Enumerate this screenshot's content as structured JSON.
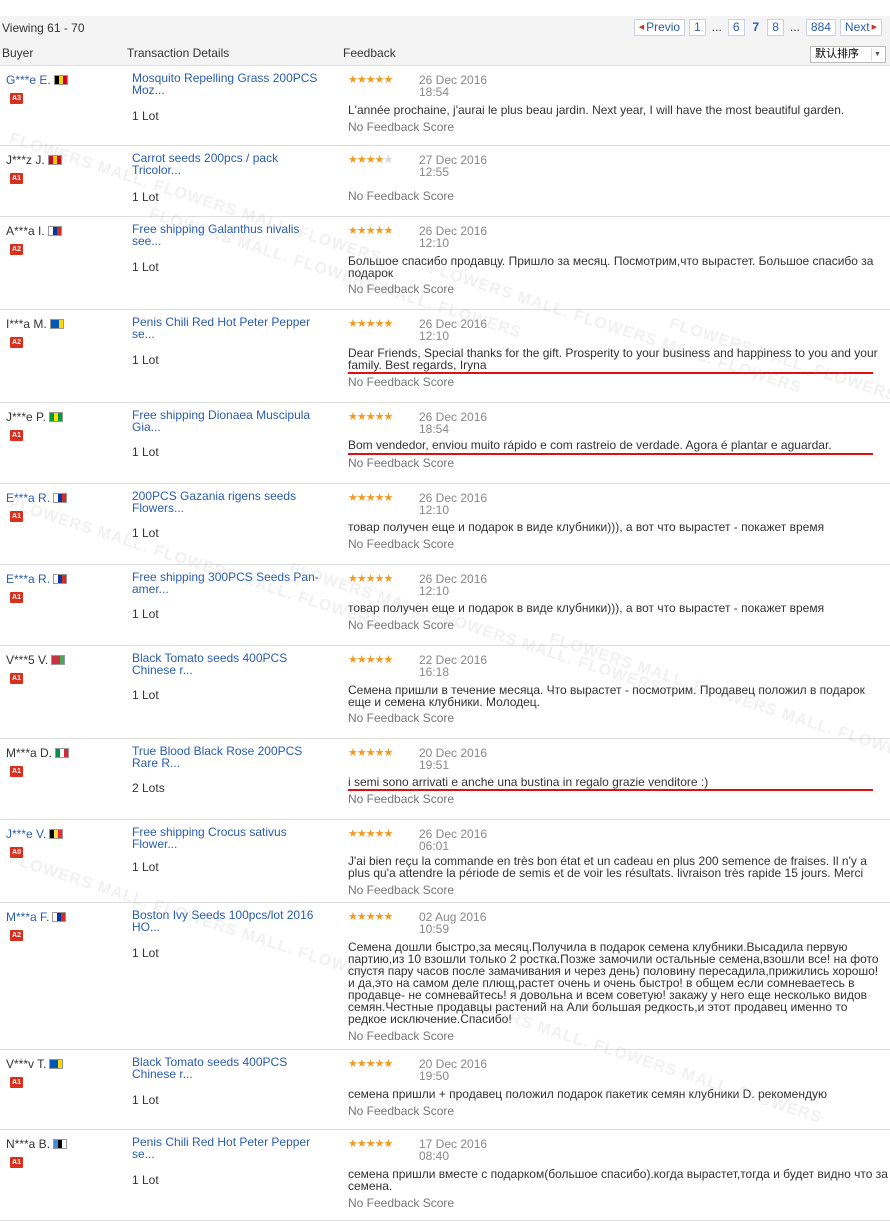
{
  "pagination": {
    "viewing": "Viewing 61 - 70",
    "prev_label": "Previo",
    "pages": [
      "1",
      "...",
      "6",
      "7",
      "8",
      "...",
      "884"
    ],
    "current_page": "7",
    "next_label": "Next"
  },
  "columns": {
    "buyer": "Buyer",
    "transaction": "Transaction Details",
    "feedback": "Feedback"
  },
  "sort": {
    "selected": "默认排序"
  },
  "watermark": "FLOWERS MALL. FLOWERS MALL. FLOWERS",
  "colors": {
    "link": "#2a5db0",
    "star": "#f39a1e",
    "badge": "#d9301e",
    "underline": "#e01010"
  },
  "rows": [
    {
      "buyer": "G***e E.",
      "flag": [
        "#000000",
        "#f5d000",
        "#d2001f"
      ],
      "level": "A3",
      "product": "Mosquito Repelling Grass 200PCS Moz...",
      "lots": "1 Lot",
      "stars": 5,
      "date": "26 Dec 2016",
      "time": "18:54",
      "feedback": "L'année prochaine, j'aurai le plus beau jardin. Next year, I will have the most beautiful garden.",
      "score": "No Feedback Score"
    },
    {
      "buyer": "J***z J.",
      "flag": [
        "#c60b1e",
        "#ffc400",
        "#c60b1e"
      ],
      "level": "A1",
      "product": "Carrot seeds 200pcs / pack Tricolor...",
      "lots": "1 Lot",
      "stars": 4,
      "date": "27 Dec 2016",
      "time": "12:55",
      "feedback": "",
      "score": "No Feedback Score"
    },
    {
      "buyer": "A***a I.",
      "flag": [
        "#ffffff",
        "#0039a6",
        "#d52b1e"
      ],
      "level": "A2",
      "product": "Free shipping Galanthus nivalis see...",
      "lots": "1 Lot",
      "stars": 5,
      "date": "26 Dec 2016",
      "time": "12:10",
      "feedback": "Большое спасибо продавцу. Пришло за месяц. Посмотрим,что вырастет. Большое спасибо за подарок",
      "score": "No Feedback Score"
    },
    {
      "buyer": "I***a M.",
      "flag": [
        "#0057b7",
        "#0057b7",
        "#ffd700"
      ],
      "level": "A2",
      "product": "Penis Chili Red Hot Peter Pepper se...",
      "lots": "1 Lot",
      "stars": 5,
      "date": "26 Dec 2016",
      "time": "12:10",
      "feedback": "Dear Friends, Special thanks for the gift. Prosperity to your business and happiness to you and your family. Best regards, Iryna",
      "score": "No Feedback Score"
    },
    {
      "buyer": "J***e P.",
      "flag": [
        "#009c3b",
        "#ffdf00",
        "#009c3b"
      ],
      "level": "A1",
      "product": "Free shipping Dionaea Muscipula Gia...",
      "lots": "1 Lot",
      "stars": 5,
      "date": "26 Dec 2016",
      "time": "18:54",
      "feedback": "Bom vendedor, enviou muito rápido e com rastreio de verdade. Agora é plantar e aguardar.",
      "score": "No Feedback Score"
    },
    {
      "buyer": "E***a R.",
      "flag": [
        "#ffffff",
        "#0039a6",
        "#d52b1e"
      ],
      "level": "A1",
      "product": "200PCS Gazania rigens seeds Flowers...",
      "lots": "1 Lot",
      "stars": 5,
      "date": "26 Dec 2016",
      "time": "12:10",
      "feedback": "товар получен еще и подарок в виде клубники))), а вот что вырастет - покажет время",
      "score": "No Feedback Score"
    },
    {
      "buyer": "E***a R.",
      "flag": [
        "#ffffff",
        "#0039a6",
        "#d52b1e"
      ],
      "level": "A1",
      "product": "Free shipping 300PCS Seeds Pan-amer...",
      "lots": "1 Lot",
      "stars": 5,
      "date": "26 Dec 2016",
      "time": "12:10",
      "feedback": "товар получен еще и подарок в виде клубники))), а вот что вырастет - покажет время",
      "score": "No Feedback Score"
    },
    {
      "buyer": "V***5 V.",
      "flag": [
        "#c8313e",
        "#c8313e",
        "#4aa657"
      ],
      "level": "A1",
      "product": "Black Tomato seeds 400PCS Chinese r...",
      "lots": "1 Lot",
      "stars": 5,
      "date": "22 Dec 2016",
      "time": "16:18",
      "feedback": "Семена пришли в течение месяца. Что вырастет - посмотрим. Продавец положил в подарок еще и семена клубники. Молодец.",
      "score": "No Feedback Score"
    },
    {
      "buyer": "M***a D.",
      "flag": [
        "#009246",
        "#ffffff",
        "#ce2b37"
      ],
      "level": "A1",
      "product": "True Blood Black Rose 200PCS Rare R...",
      "lots": "2 Lots",
      "stars": 5,
      "date": "20 Dec 2016",
      "time": "19:51",
      "feedback": "i semi sono arrivati e anche una bustina in regalo grazie venditore :)",
      "score": "No Feedback Score"
    },
    {
      "buyer": "J***e V.",
      "flag": [
        "#000000",
        "#fae042",
        "#ed2939"
      ],
      "level": "A0",
      "product": "Free shipping Crocus sativus Flower...",
      "lots": "1 Lot",
      "stars": 5,
      "date": "26 Dec 2016",
      "time": "06:01",
      "feedback": "J'ai bien reçu la commande en très bon état et un cadeau en plus 200 semence de fraises. Il n'y a plus qu'a attendre la période de semis et de voir les résultats. livraison très rapide 15 jours. Merci",
      "score": "No Feedback Score"
    },
    {
      "buyer": "M***a F.",
      "flag": [
        "#ffffff",
        "#0039a6",
        "#d52b1e"
      ],
      "level": "A2",
      "product": "Boston Ivy Seeds 100pcs/lot 2016 HO...",
      "lots": "1 Lot",
      "stars": 5,
      "date": "02 Aug 2016",
      "time": "10:59",
      "feedback": "Семена дошли быстро,за месяц.Получила в подарок семена клубники.Высадила первую партию,из 10 взошли только 2 ростка.Позже замочили остальные семена,взошли все! на фото спустя пару часов после замачивания и через день) половину пересадила,прижились хорошо! и да,это на самом деле плющ,растет очень и очень быстро! в общем если сомневаетесь в продавце- не сомневайтесь! я довольна и всем советую! закажу у него еще несколько видов семян.Честные продавцы растений на Али большая редкость,и этот продавец именно то редкое исключение.Спасибо!",
      "score": "No Feedback Score"
    },
    {
      "buyer": "V***v T.",
      "flag": [
        "#0057b7",
        "#0057b7",
        "#ffd700"
      ],
      "level": "A1",
      "product": "Black Tomato seeds 400PCS Chinese r...",
      "lots": "1 Lot",
      "stars": 5,
      "date": "20 Dec 2016",
      "time": "19:50",
      "feedback": "семена пришли + продавец положил подарок пакетик семян клубники D. рекомендую",
      "score": "No Feedback Score"
    },
    {
      "buyer": "N***a B.",
      "flag": [
        "#4189dd",
        "#000000",
        "#ffffff"
      ],
      "level": "A1",
      "product": "Penis Chili Red Hot Peter Pepper se...",
      "lots": "1 Lot",
      "stars": 5,
      "date": "17 Dec 2016",
      "time": "08:40",
      "feedback": "семена пришли вместе с подарком(большое спасибо).когда вырастет,тогда и будет видно что за семена.",
      "score": "No Feedback Score"
    }
  ]
}
